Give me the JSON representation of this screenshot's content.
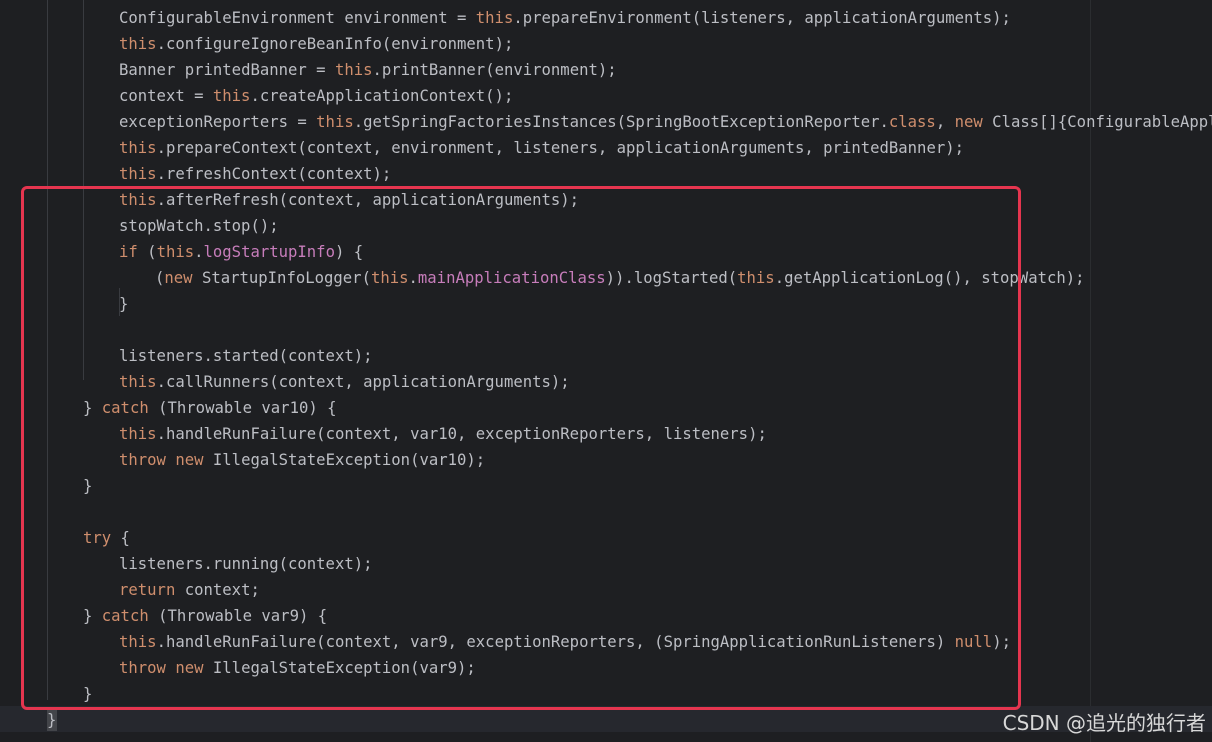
{
  "editor": {
    "lines": [
      "ConfigurableEnvironment environment = this.prepareEnvironment(listeners, applicationArguments);",
      "this.configureIgnoreBeanInfo(environment);",
      "Banner printedBanner = this.printBanner(environment);",
      "context = this.createApplicationContext();",
      "exceptionReporters = this.getSpringFactoriesInstances(SpringBootExceptionReporter.class, new Class[]{ConfigurableApplicati",
      "this.prepareContext(context, environment, listeners, applicationArguments, printedBanner);",
      "this.refreshContext(context);",
      "this.afterRefresh(context, applicationArguments);",
      "stopWatch.stop();",
      "if (this.logStartupInfo) {",
      "(new StartupInfoLogger(this.mainApplicationClass)).logStarted(this.getApplicationLog(), stopWatch);",
      "}",
      "",
      "listeners.started(context);",
      "this.callRunners(context, applicationArguments);",
      "} catch (Throwable var10) {",
      "this.handleRunFailure(context, var10, exceptionReporters, listeners);",
      "throw new IllegalStateException(var10);",
      "}",
      "",
      "try {",
      "listeners.running(context);",
      "return context;",
      "} catch (Throwable var9) {",
      "this.handleRunFailure(context, var9, exceptionReporters, (SpringApplicationRunListeners) null);",
      "throw new IllegalStateException(var9);",
      "}",
      "}"
    ],
    "highlight_color": "#e5354f"
  },
  "watermark": "CSDN @追光的独行者"
}
